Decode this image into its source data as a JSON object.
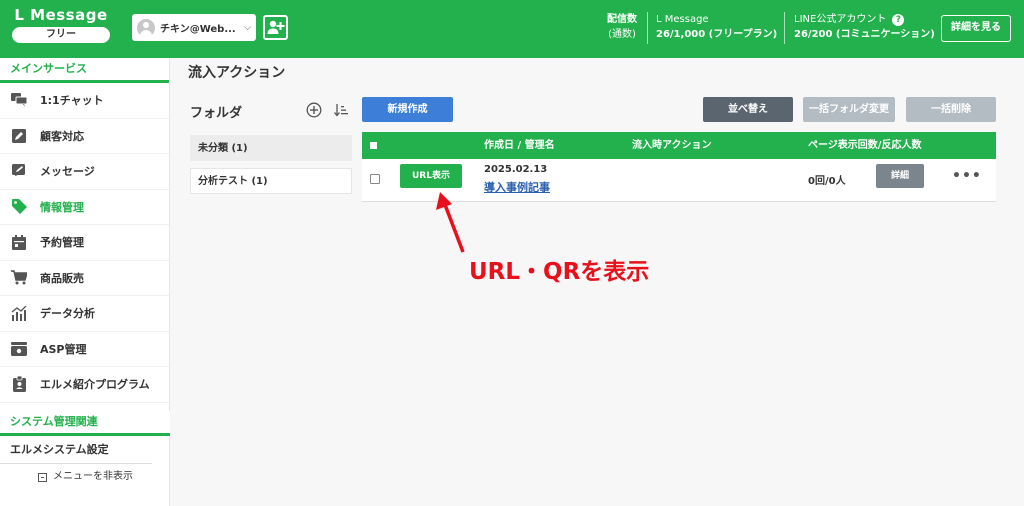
{
  "header": {
    "logo_title": "L Message",
    "plan": "フリー",
    "account_name": "チキン@Web...",
    "stats": [
      {
        "label": "配信数",
        "sub": "(通数)"
      },
      {
        "label": "L Message",
        "sub": "26/1,000 (フリープラン)"
      },
      {
        "label": "LINE公式アカウント",
        "sub": "26/200 (コミュニケーション)"
      }
    ],
    "detail_button": "詳細を見る",
    "help_glyph": "?"
  },
  "sidebar": {
    "main_section": "メインサービス",
    "items": [
      {
        "label": "1:1チャット",
        "icon": "chat-icon",
        "active": false
      },
      {
        "label": "顧客対応",
        "icon": "edit-square-icon",
        "active": false
      },
      {
        "label": "メッセージ",
        "icon": "message-edit-icon",
        "active": false
      },
      {
        "label": "情報管理",
        "icon": "tag-icon",
        "active": true
      },
      {
        "label": "予約管理",
        "icon": "calendar-icon",
        "active": false
      },
      {
        "label": "商品販売",
        "icon": "cart-icon",
        "active": false
      },
      {
        "label": "データ分析",
        "icon": "chart-icon",
        "active": false
      },
      {
        "label": "ASP管理",
        "icon": "wallet-icon",
        "active": false
      },
      {
        "label": "エルメ紹介プログラム",
        "icon": "badge-icon",
        "active": false
      }
    ],
    "system_section": "システム管理関連",
    "system_item": "エルメシステム設定",
    "hide_menu": "メニューを非表示"
  },
  "main": {
    "page_title": "流入アクション",
    "folder_title": "フォルダ",
    "folders": [
      {
        "label": "未分類 (1)",
        "selected": true
      },
      {
        "label": "分析テスト (1)",
        "selected": false
      }
    ],
    "buttons": {
      "new": "新規作成",
      "sort": "並べ替え",
      "bulk_folder": "一括フォルダ変更",
      "bulk_delete": "一括削除"
    },
    "table": {
      "columns": [
        "作成日 / 管理名",
        "流入時アクション",
        "ページ表示回数/反応人数"
      ],
      "rows": [
        {
          "url_button": "URL表示",
          "date": "2025.02.13",
          "name": "導入事例記事",
          "action": "",
          "views": "0回/0人",
          "detail_button": "詳細",
          "more": "•••"
        }
      ]
    }
  },
  "annotation": {
    "text": "URL・QRを表示",
    "color": "#e8101a"
  },
  "colors": {
    "brand_green": "#22b14c",
    "primary_blue": "#3d7ed8",
    "dark_gray": "#5a6570",
    "light_gray": "#b3bcc3"
  }
}
